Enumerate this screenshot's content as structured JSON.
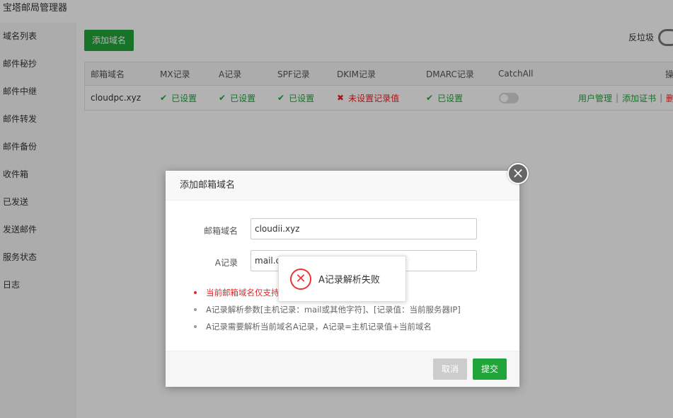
{
  "app": {
    "title": "宝塔邮局管理器"
  },
  "sidebar": {
    "items": [
      {
        "label": "域名列表"
      },
      {
        "label": "邮件秘抄"
      },
      {
        "label": "邮件中继"
      },
      {
        "label": "邮件转发"
      },
      {
        "label": "邮件备份"
      },
      {
        "label": "收件箱"
      },
      {
        "label": "已发送"
      },
      {
        "label": "发送邮件"
      },
      {
        "label": "服务状态"
      },
      {
        "label": "日志"
      }
    ]
  },
  "toolbar": {
    "add_domain_label": "添加域名",
    "spam_label": "反垃圾"
  },
  "table": {
    "headers": [
      "邮箱域名",
      "MX记录",
      "A记录",
      "SPF记录",
      "DKIM记录",
      "DMARC记录",
      "CatchAll",
      "操"
    ],
    "rows": [
      {
        "domain": "cloudpc.xyz",
        "mx": "已设置",
        "a": "已设置",
        "spf": "已设置",
        "dkim": "未设置记录值",
        "dmarc": "已设置",
        "ops": {
          "user_mgmt": "用户管理",
          "add_cert": "添加证书",
          "delete": "删"
        }
      }
    ],
    "status_colors": {
      "ok": "#20a53a",
      "error": "#ee2222"
    }
  },
  "modal": {
    "title": "添加邮箱域名",
    "close_icon": "close-icon",
    "domain_label": "邮箱域名",
    "domain_value": "cloudii.xyz",
    "a_label": "A记录",
    "a_value": "mail.cloudii.xyz",
    "tips": [
      "当前邮箱域名仅支持",
      "A记录解析参数[主机记录：mail或其他字符]、[记录值：当前服务器IP]",
      "A记录需要解析当前域名A记录，A记录=主机记录值+当前域名"
    ],
    "cancel_label": "取消",
    "submit_label": "提交"
  },
  "toast": {
    "icon": "error-icon",
    "message": "A记录解析失败"
  },
  "colors": {
    "brand_green": "#20a53a",
    "error_red": "#ee2222"
  }
}
